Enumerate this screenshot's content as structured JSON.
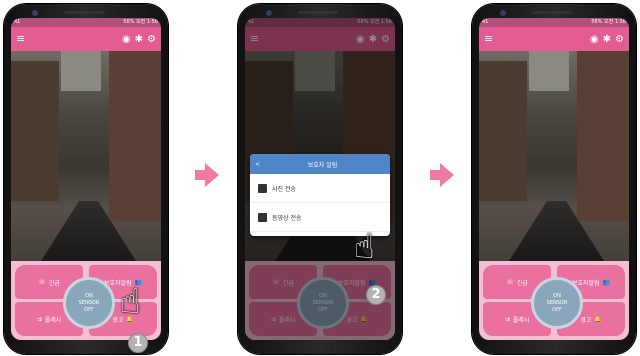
{
  "status_bar": {
    "left": "41",
    "right": "56% 오전 1:56"
  },
  "menu_icon": "≡",
  "appbar_icons": [
    "wifi-icon",
    "share-icon",
    "settings-icon"
  ],
  "controls": {
    "emergency": "긴급",
    "guardian_alarm": "보호자알림",
    "siren": "폴레시",
    "warning": "경고",
    "sensor_line1": "ON",
    "sensor_line2": "SENSOR",
    "sensor_line3": "OFF"
  },
  "dialog": {
    "back": "<",
    "title": "보호자 알림",
    "items": [
      "사진 전송",
      "동영상 전송"
    ]
  },
  "steps": [
    "1",
    "2"
  ]
}
